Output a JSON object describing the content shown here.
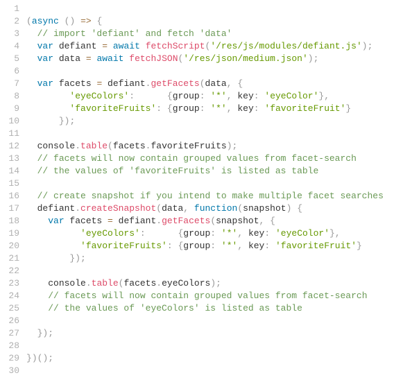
{
  "lines": [
    {
      "num": "1",
      "tokens": []
    },
    {
      "num": "2",
      "tokens": [
        {
          "t": "pn",
          "v": "("
        },
        {
          "t": "kw",
          "v": "async"
        },
        {
          "t": "id",
          "v": " "
        },
        {
          "t": "pn",
          "v": "("
        },
        {
          "t": "pn",
          "v": ")"
        },
        {
          "t": "id",
          "v": " "
        },
        {
          "t": "op",
          "v": "=>"
        },
        {
          "t": "id",
          "v": " "
        },
        {
          "t": "pn",
          "v": "{"
        }
      ]
    },
    {
      "num": "3",
      "indent": "  ",
      "tokens": [
        {
          "t": "com",
          "v": "// import 'defiant' and fetch 'data'"
        }
      ]
    },
    {
      "num": "4",
      "indent": "  ",
      "tokens": [
        {
          "t": "kw",
          "v": "var"
        },
        {
          "t": "id",
          "v": " defiant "
        },
        {
          "t": "op",
          "v": "="
        },
        {
          "t": "id",
          "v": " "
        },
        {
          "t": "kw",
          "v": "await"
        },
        {
          "t": "id",
          "v": " "
        },
        {
          "t": "fn",
          "v": "fetchScript"
        },
        {
          "t": "pn",
          "v": "("
        },
        {
          "t": "str",
          "v": "'/res/js/modules/defiant.js'"
        },
        {
          "t": "pn",
          "v": ")"
        },
        {
          "t": "pn",
          "v": ";"
        }
      ]
    },
    {
      "num": "5",
      "indent": "  ",
      "tokens": [
        {
          "t": "kw",
          "v": "var"
        },
        {
          "t": "id",
          "v": " data "
        },
        {
          "t": "op",
          "v": "="
        },
        {
          "t": "id",
          "v": " "
        },
        {
          "t": "kw",
          "v": "await"
        },
        {
          "t": "id",
          "v": " "
        },
        {
          "t": "fn",
          "v": "fetchJSON"
        },
        {
          "t": "pn",
          "v": "("
        },
        {
          "t": "str",
          "v": "'/res/json/medium.json'"
        },
        {
          "t": "pn",
          "v": ")"
        },
        {
          "t": "pn",
          "v": ";"
        }
      ]
    },
    {
      "num": "6",
      "tokens": []
    },
    {
      "num": "7",
      "indent": "  ",
      "tokens": [
        {
          "t": "kw",
          "v": "var"
        },
        {
          "t": "id",
          "v": " facets "
        },
        {
          "t": "op",
          "v": "="
        },
        {
          "t": "id",
          "v": " defiant"
        },
        {
          "t": "pn",
          "v": "."
        },
        {
          "t": "fn",
          "v": "getFacets"
        },
        {
          "t": "pn",
          "v": "("
        },
        {
          "t": "id",
          "v": "data"
        },
        {
          "t": "pn",
          "v": ","
        },
        {
          "t": "id",
          "v": " "
        },
        {
          "t": "pn",
          "v": "{"
        }
      ]
    },
    {
      "num": "8",
      "indent": "        ",
      "tokens": [
        {
          "t": "str",
          "v": "'eyeColors'"
        },
        {
          "t": "pn",
          "v": ":"
        },
        {
          "t": "id",
          "v": "      "
        },
        {
          "t": "pn",
          "v": "{"
        },
        {
          "t": "id",
          "v": "group"
        },
        {
          "t": "pn",
          "v": ":"
        },
        {
          "t": "id",
          "v": " "
        },
        {
          "t": "str",
          "v": "'*'"
        },
        {
          "t": "pn",
          "v": ","
        },
        {
          "t": "id",
          "v": " key"
        },
        {
          "t": "pn",
          "v": ":"
        },
        {
          "t": "id",
          "v": " "
        },
        {
          "t": "str",
          "v": "'eyeColor'"
        },
        {
          "t": "pn",
          "v": "}"
        },
        {
          "t": "pn",
          "v": ","
        }
      ]
    },
    {
      "num": "9",
      "indent": "        ",
      "tokens": [
        {
          "t": "str",
          "v": "'favoriteFruits'"
        },
        {
          "t": "pn",
          "v": ":"
        },
        {
          "t": "id",
          "v": " "
        },
        {
          "t": "pn",
          "v": "{"
        },
        {
          "t": "id",
          "v": "group"
        },
        {
          "t": "pn",
          "v": ":"
        },
        {
          "t": "id",
          "v": " "
        },
        {
          "t": "str",
          "v": "'*'"
        },
        {
          "t": "pn",
          "v": ","
        },
        {
          "t": "id",
          "v": " key"
        },
        {
          "t": "pn",
          "v": ":"
        },
        {
          "t": "id",
          "v": " "
        },
        {
          "t": "str",
          "v": "'favoriteFruit'"
        },
        {
          "t": "pn",
          "v": "}"
        }
      ]
    },
    {
      "num": "10",
      "indent": "      ",
      "tokens": [
        {
          "t": "pn",
          "v": "}"
        },
        {
          "t": "pn",
          "v": ")"
        },
        {
          "t": "pn",
          "v": ";"
        }
      ]
    },
    {
      "num": "11",
      "tokens": []
    },
    {
      "num": "12",
      "indent": "  ",
      "tokens": [
        {
          "t": "id",
          "v": "console"
        },
        {
          "t": "pn",
          "v": "."
        },
        {
          "t": "fn",
          "v": "table"
        },
        {
          "t": "pn",
          "v": "("
        },
        {
          "t": "id",
          "v": "facets"
        },
        {
          "t": "pn",
          "v": "."
        },
        {
          "t": "id",
          "v": "favoriteFruits"
        },
        {
          "t": "pn",
          "v": ")"
        },
        {
          "t": "pn",
          "v": ";"
        }
      ]
    },
    {
      "num": "13",
      "indent": "  ",
      "tokens": [
        {
          "t": "com",
          "v": "// facets will now contain grouped values from facet-search"
        }
      ]
    },
    {
      "num": "14",
      "indent": "  ",
      "tokens": [
        {
          "t": "com",
          "v": "// the values of 'favoriteFruits' is listed as table"
        }
      ]
    },
    {
      "num": "15",
      "tokens": []
    },
    {
      "num": "16",
      "indent": "  ",
      "tokens": [
        {
          "t": "com",
          "v": "// create snapshot if you intend to make multiple facet searches"
        }
      ]
    },
    {
      "num": "17",
      "indent": "  ",
      "tokens": [
        {
          "t": "id",
          "v": "defiant"
        },
        {
          "t": "pn",
          "v": "."
        },
        {
          "t": "fn",
          "v": "createSnapshot"
        },
        {
          "t": "pn",
          "v": "("
        },
        {
          "t": "id",
          "v": "data"
        },
        {
          "t": "pn",
          "v": ","
        },
        {
          "t": "id",
          "v": " "
        },
        {
          "t": "kw",
          "v": "function"
        },
        {
          "t": "pn",
          "v": "("
        },
        {
          "t": "id",
          "v": "snapshot"
        },
        {
          "t": "pn",
          "v": ")"
        },
        {
          "t": "id",
          "v": " "
        },
        {
          "t": "pn",
          "v": "{"
        }
      ]
    },
    {
      "num": "18",
      "indent": "    ",
      "tokens": [
        {
          "t": "kw",
          "v": "var"
        },
        {
          "t": "id",
          "v": " facets "
        },
        {
          "t": "op",
          "v": "="
        },
        {
          "t": "id",
          "v": " defiant"
        },
        {
          "t": "pn",
          "v": "."
        },
        {
          "t": "fn",
          "v": "getFacets"
        },
        {
          "t": "pn",
          "v": "("
        },
        {
          "t": "id",
          "v": "snapshot"
        },
        {
          "t": "pn",
          "v": ","
        },
        {
          "t": "id",
          "v": " "
        },
        {
          "t": "pn",
          "v": "{"
        }
      ]
    },
    {
      "num": "19",
      "indent": "          ",
      "tokens": [
        {
          "t": "str",
          "v": "'eyeColors'"
        },
        {
          "t": "pn",
          "v": ":"
        },
        {
          "t": "id",
          "v": "      "
        },
        {
          "t": "pn",
          "v": "{"
        },
        {
          "t": "id",
          "v": "group"
        },
        {
          "t": "pn",
          "v": ":"
        },
        {
          "t": "id",
          "v": " "
        },
        {
          "t": "str",
          "v": "'*'"
        },
        {
          "t": "pn",
          "v": ","
        },
        {
          "t": "id",
          "v": " key"
        },
        {
          "t": "pn",
          "v": ":"
        },
        {
          "t": "id",
          "v": " "
        },
        {
          "t": "str",
          "v": "'eyeColor'"
        },
        {
          "t": "pn",
          "v": "}"
        },
        {
          "t": "pn",
          "v": ","
        }
      ]
    },
    {
      "num": "20",
      "indent": "          ",
      "tokens": [
        {
          "t": "str",
          "v": "'favoriteFruits'"
        },
        {
          "t": "pn",
          "v": ":"
        },
        {
          "t": "id",
          "v": " "
        },
        {
          "t": "pn",
          "v": "{"
        },
        {
          "t": "id",
          "v": "group"
        },
        {
          "t": "pn",
          "v": ":"
        },
        {
          "t": "id",
          "v": " "
        },
        {
          "t": "str",
          "v": "'*'"
        },
        {
          "t": "pn",
          "v": ","
        },
        {
          "t": "id",
          "v": " key"
        },
        {
          "t": "pn",
          "v": ":"
        },
        {
          "t": "id",
          "v": " "
        },
        {
          "t": "str",
          "v": "'favoriteFruit'"
        },
        {
          "t": "pn",
          "v": "}"
        }
      ]
    },
    {
      "num": "21",
      "indent": "        ",
      "tokens": [
        {
          "t": "pn",
          "v": "}"
        },
        {
          "t": "pn",
          "v": ")"
        },
        {
          "t": "pn",
          "v": ";"
        }
      ]
    },
    {
      "num": "22",
      "tokens": []
    },
    {
      "num": "23",
      "indent": "    ",
      "tokens": [
        {
          "t": "id",
          "v": "console"
        },
        {
          "t": "pn",
          "v": "."
        },
        {
          "t": "fn",
          "v": "table"
        },
        {
          "t": "pn",
          "v": "("
        },
        {
          "t": "id",
          "v": "facets"
        },
        {
          "t": "pn",
          "v": "."
        },
        {
          "t": "id",
          "v": "eyeColors"
        },
        {
          "t": "pn",
          "v": ")"
        },
        {
          "t": "pn",
          "v": ";"
        }
      ]
    },
    {
      "num": "24",
      "indent": "    ",
      "tokens": [
        {
          "t": "com",
          "v": "// facets will now contain grouped values from facet-search"
        }
      ]
    },
    {
      "num": "25",
      "indent": "    ",
      "tokens": [
        {
          "t": "com",
          "v": "// the values of 'eyeColors' is listed as table"
        }
      ]
    },
    {
      "num": "26",
      "tokens": []
    },
    {
      "num": "27",
      "indent": "  ",
      "tokens": [
        {
          "t": "pn",
          "v": "}"
        },
        {
          "t": "pn",
          "v": ")"
        },
        {
          "t": "pn",
          "v": ";"
        }
      ]
    },
    {
      "num": "28",
      "tokens": []
    },
    {
      "num": "29",
      "tokens": [
        {
          "t": "pn",
          "v": "}"
        },
        {
          "t": "pn",
          "v": ")"
        },
        {
          "t": "pn",
          "v": "("
        },
        {
          "t": "pn",
          "v": ")"
        },
        {
          "t": "pn",
          "v": ";"
        }
      ]
    },
    {
      "num": "30",
      "tokens": []
    }
  ]
}
